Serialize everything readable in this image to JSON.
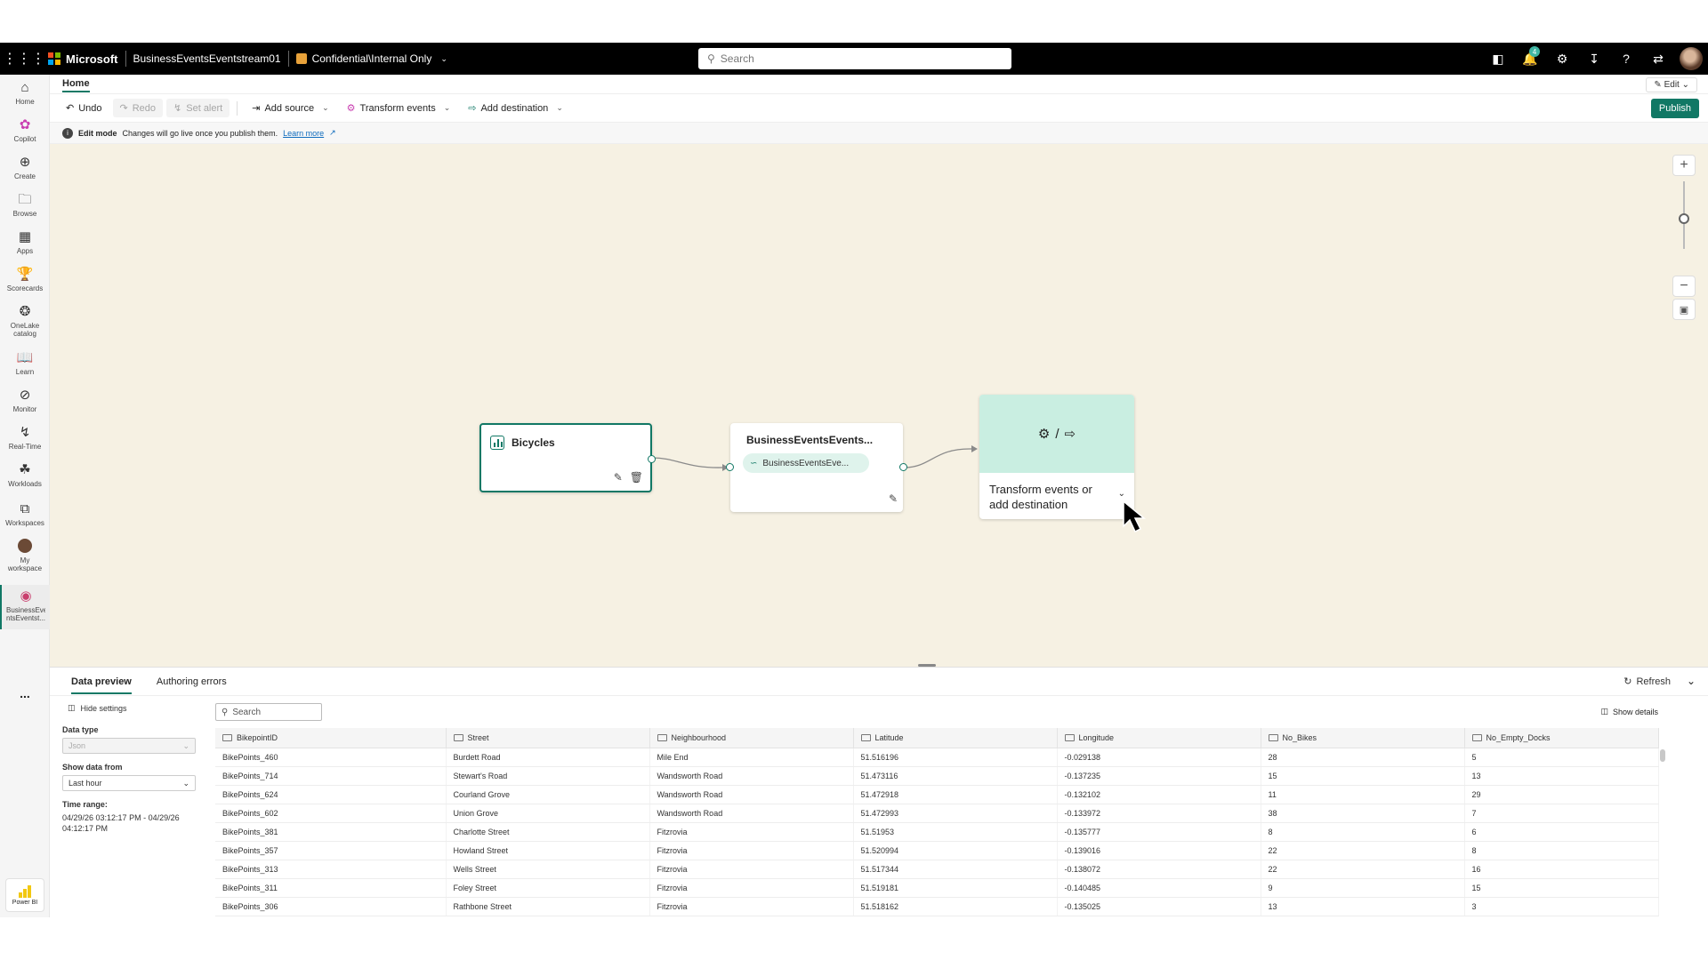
{
  "topbar": {
    "brand": "Microsoft",
    "item_name": "BusinessEventsEventstream01",
    "sensitivity": "Confidential\\Internal Only",
    "search_placeholder": "Search",
    "notification_count": "4"
  },
  "rail": {
    "items": [
      {
        "label": "Home"
      },
      {
        "label": "Copilot"
      },
      {
        "label": "Create"
      },
      {
        "label": "Browse"
      },
      {
        "label": "Apps"
      },
      {
        "label": "Scorecards"
      },
      {
        "label": "OneLake catalog"
      },
      {
        "label": "Learn"
      },
      {
        "label": "Monitor"
      },
      {
        "label": "Real-Time"
      },
      {
        "label": "Workloads"
      },
      {
        "label": "Workspaces"
      },
      {
        "label": "My workspace"
      },
      {
        "label": "BusinessEve ntsEventst..."
      }
    ],
    "more": "...",
    "footer": "Power BI"
  },
  "ribbon": {
    "tab": "Home",
    "edit": "Edit",
    "undo": "Undo",
    "redo": "Redo",
    "set_alert": "Set alert",
    "add_source": "Add source",
    "transform_events": "Transform events",
    "add_destination": "Add destination",
    "publish": "Publish"
  },
  "infobar": {
    "mode": "Edit mode",
    "message": "Changes will go live once you publish them.",
    "link": "Learn more"
  },
  "canvas": {
    "source_node": "Bicycles",
    "stream_node_title": "BusinessEventsEvents...",
    "stream_node_pill": "BusinessEventsEve...",
    "dest_node_label_line1": "Transform events or",
    "dest_node_label_line2": "add destination",
    "dest_node_icons_sep": "/"
  },
  "panel": {
    "tabs": [
      "Data preview",
      "Authoring errors"
    ],
    "refresh": "Refresh",
    "hide_settings": "Hide settings",
    "data_type_label": "Data type",
    "data_type_value": "Json",
    "show_from_label": "Show data from",
    "show_from_value": "Last hour",
    "time_range_label": "Time range:",
    "time_range_value": "04/29/26 03:12:17 PM - 04/29/26 04:12:17 PM",
    "search_placeholder": "Search",
    "show_details": "Show details",
    "columns": [
      "BikepointID",
      "Street",
      "Neighbourhood",
      "Latitude",
      "Longitude",
      "No_Bikes",
      "No_Empty_Docks"
    ],
    "rows": [
      [
        "BikePoints_460",
        "Burdett Road",
        "Mile End",
        "51.516196",
        "-0.029138",
        "28",
        "5"
      ],
      [
        "BikePoints_714",
        "Stewart's Road",
        "Wandsworth Road",
        "51.473116",
        "-0.137235",
        "15",
        "13"
      ],
      [
        "BikePoints_624",
        "Courland Grove",
        "Wandsworth Road",
        "51.472918",
        "-0.132102",
        "11",
        "29"
      ],
      [
        "BikePoints_602",
        "Union Grove",
        "Wandsworth Road",
        "51.472993",
        "-0.133972",
        "38",
        "7"
      ],
      [
        "BikePoints_381",
        "Charlotte Street",
        "Fitzrovia",
        "51.51953",
        "-0.135777",
        "8",
        "6"
      ],
      [
        "BikePoints_357",
        "Howland Street",
        "Fitzrovia",
        "51.520994",
        "-0.139016",
        "22",
        "8"
      ],
      [
        "BikePoints_313",
        "Wells Street",
        "Fitzrovia",
        "51.517344",
        "-0.138072",
        "22",
        "16"
      ],
      [
        "BikePoints_311",
        "Foley Street",
        "Fitzrovia",
        "51.519181",
        "-0.140485",
        "9",
        "15"
      ],
      [
        "BikePoints_306",
        "Rathbone Street",
        "Fitzrovia",
        "51.518162",
        "-0.135025",
        "13",
        "3"
      ]
    ]
  },
  "colors": {
    "accent": "#117865",
    "canvas_bg": "#f6f1e3",
    "dest_node_top": "#c9eee1"
  }
}
